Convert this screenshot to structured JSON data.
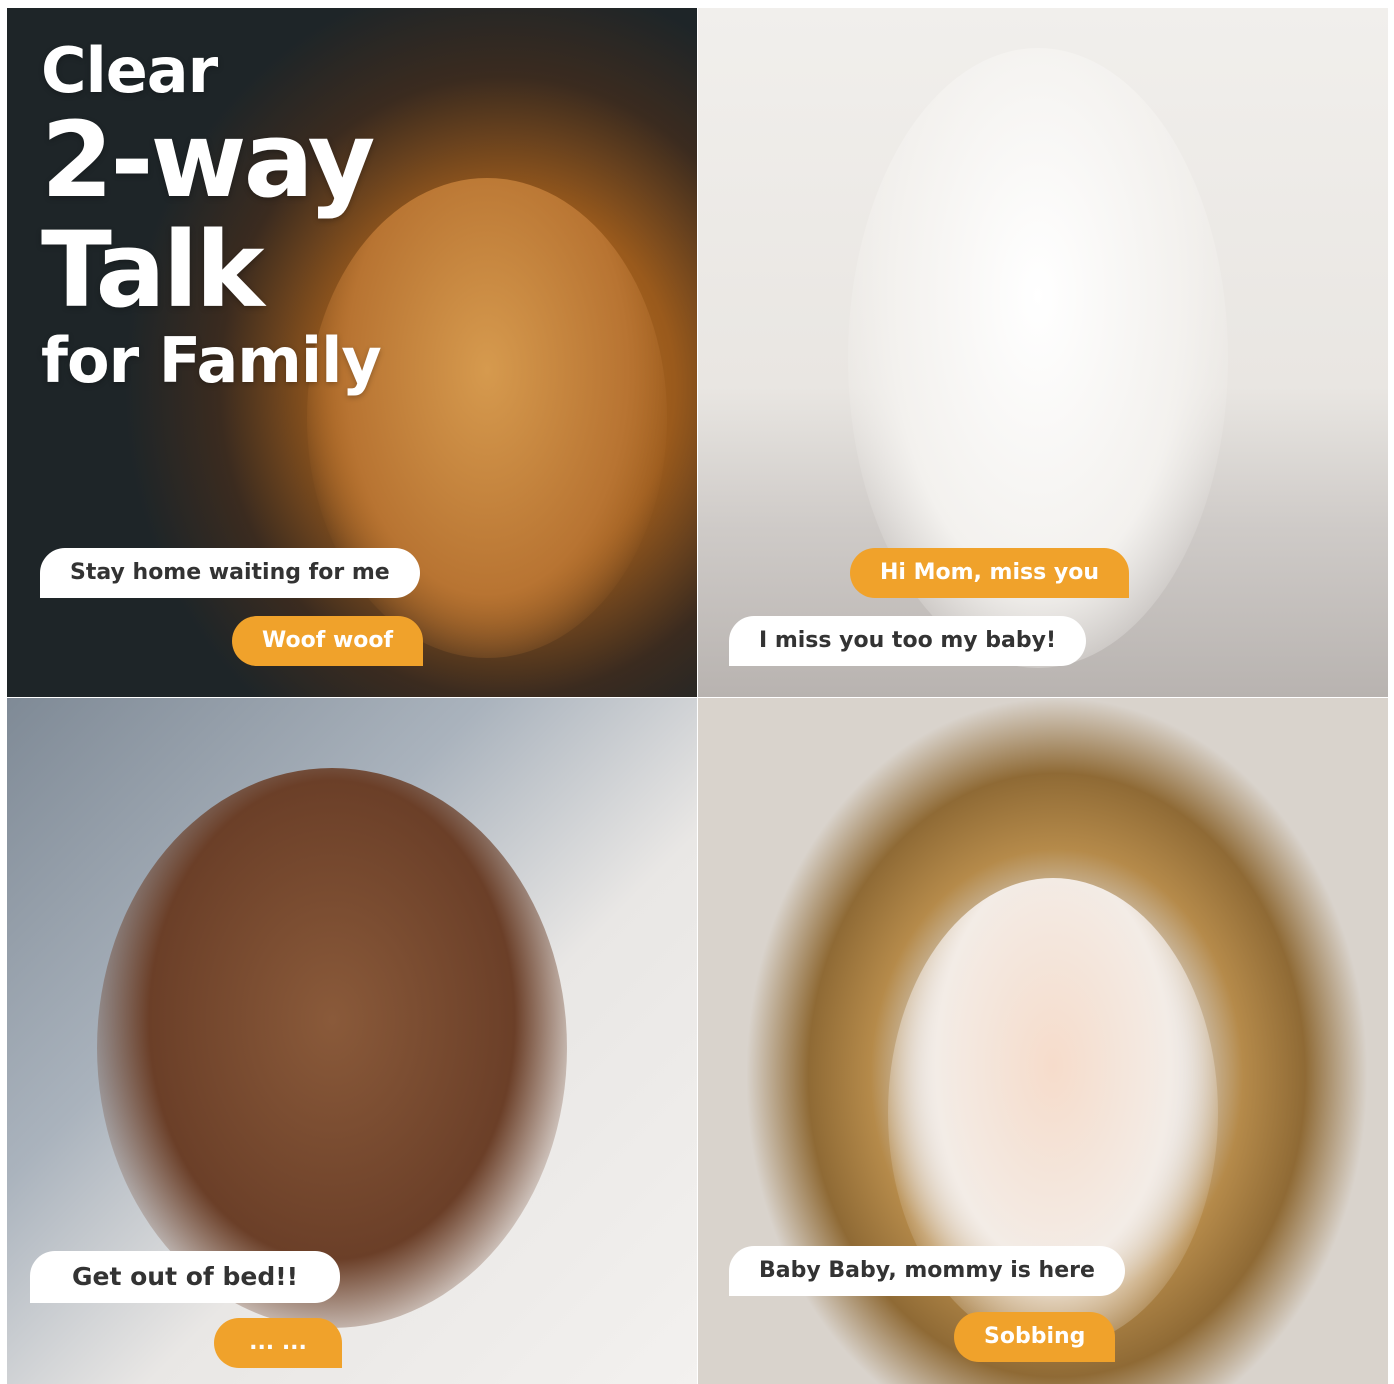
{
  "colors": {
    "bubble_orange": "#f0a22b",
    "bubble_white": "#ffffff",
    "bubble_text_dark": "#333333"
  },
  "headline": {
    "line1": "Clear",
    "line2": "2-way",
    "line3": "Talk",
    "line4": "for Family"
  },
  "panels": [
    {
      "bubbles": [
        {
          "text": "Stay home waiting for me",
          "style": "white"
        },
        {
          "text": "Woof woof",
          "style": "orange"
        }
      ]
    },
    {
      "bubbles": [
        {
          "text": "Hi Mom, miss you",
          "style": "orange"
        },
        {
          "text": "I miss you too my baby!",
          "style": "white"
        }
      ]
    },
    {
      "bubbles": [
        {
          "text": "Get out of bed!!",
          "style": "white"
        },
        {
          "text": "... ...",
          "style": "orange"
        }
      ]
    },
    {
      "bubbles": [
        {
          "text": "Baby Baby, mommy is here",
          "style": "white"
        },
        {
          "text": "Sobbing",
          "style": "orange"
        }
      ]
    }
  ]
}
